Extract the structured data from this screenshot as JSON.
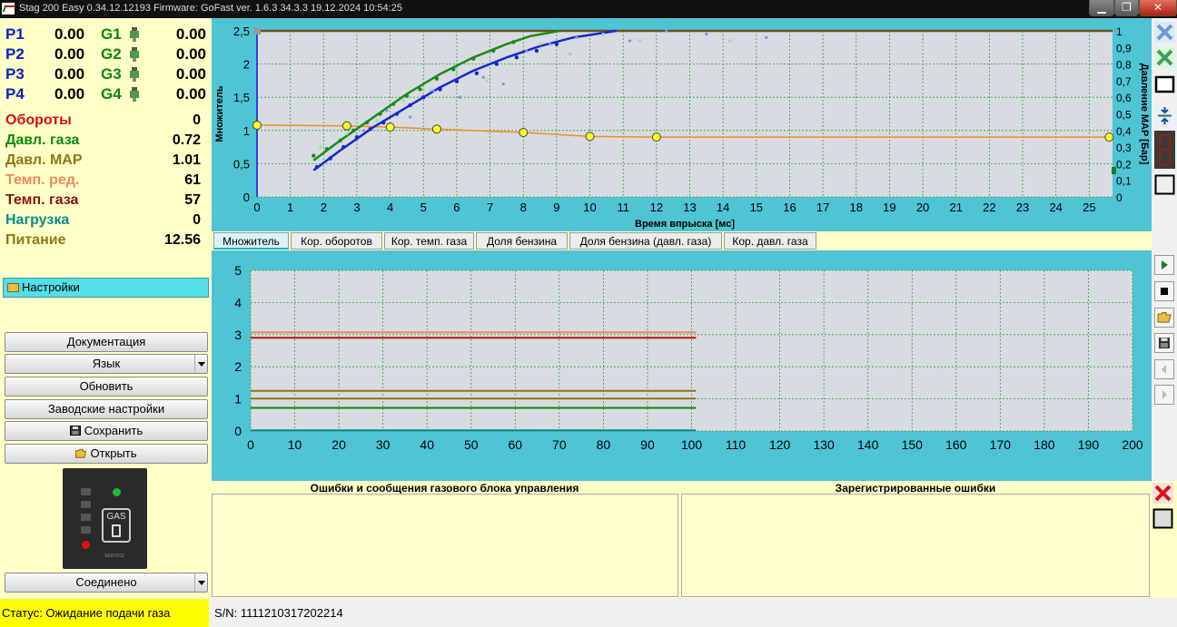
{
  "window": {
    "title": "Stag 200 Easy 0.34.12.12193 Firmware: GoFast  ver. 1.6.3  34.3.3   19.12.2024 10:54:25",
    "min": "▁",
    "max": "❐",
    "close": "✕"
  },
  "channels": [
    {
      "p": "P1",
      "pv": "0.00",
      "g": "G1",
      "gv": "0.00"
    },
    {
      "p": "P2",
      "pv": "0.00",
      "g": "G2",
      "gv": "0.00"
    },
    {
      "p": "P3",
      "pv": "0.00",
      "g": "G3",
      "gv": "0.00"
    },
    {
      "p": "P4",
      "pv": "0.00",
      "g": "G4",
      "gv": "0.00"
    }
  ],
  "params": [
    {
      "label": "Обороты",
      "value": "0",
      "color": "#d01010"
    },
    {
      "label": "Давл. газа",
      "value": "0.72",
      "color": "#0a8a0a"
    },
    {
      "label": "Давл. MAP",
      "value": "1.01",
      "color": "#8a7a10"
    },
    {
      "label": "Темп. ред.",
      "value": "61",
      "color": "#f08858"
    },
    {
      "label": "Темп. газа",
      "value": "57",
      "color": "#8a1010"
    },
    {
      "label": "Нагрузка",
      "value": "0",
      "color": "#0a8a8a"
    },
    {
      "label": "Питание",
      "value": "12.56",
      "color": "#8a7a10"
    }
  ],
  "settings": {
    "label": "Настройки"
  },
  "buttons": {
    "docs": "Документация",
    "language": "Язык",
    "update": "Обновить",
    "factory": "Заводские настройки",
    "save": "Сохранить",
    "open": "Открыть",
    "connection": "Соединено"
  },
  "device": {
    "gas": "GAS",
    "service": "SERVICE"
  },
  "tabs": [
    "Множитель",
    "Кор. оборотов",
    "Кор. темп. газа",
    "Доля бензина",
    "Доля бензина (давл. газа)",
    "Кор. давл. газа"
  ],
  "status": {
    "text": "Статус: Ожидание подачи газа",
    "serial": "S/N: 1111210317202214"
  },
  "messages": {
    "left_title": "Ошибки и сообщения газового блока управления",
    "right_title": "Зарегистрированные ошибки"
  },
  "colors": {
    "frame": "#4fc4d4",
    "plot_bg": "#d9dbe3",
    "grid": "#2ca02c",
    "orange": "#f0901a",
    "blue": "#1428d0",
    "green": "#1a8a1a",
    "brown": "#6b5218"
  },
  "icons": {
    "right_top": [
      "close-blue-icon",
      "close-green-icon",
      "window-icon",
      "compress-icon",
      "digit-icon",
      "empty-box-icon"
    ],
    "right_mid": [
      "play-icon",
      "stop-icon",
      "open-folder-icon",
      "save-disk-icon",
      "prev-icon",
      "next-icon"
    ],
    "right_bot": [
      "close-red-icon",
      "empty-box-icon"
    ]
  },
  "chart_data": [
    {
      "type": "line",
      "xlabel": "Время впрыска [мс]",
      "ylabel": "Множитель",
      "y2label": "Давление MAP [Бар]",
      "xlim": [
        0,
        25.7
      ],
      "ylim": [
        0,
        2.5
      ],
      "y2lim": [
        0,
        1
      ],
      "x_ticks": [
        0,
        1,
        2,
        3,
        4,
        5,
        6,
        7,
        8,
        9,
        10,
        11,
        12,
        13,
        14,
        15,
        16,
        17,
        18,
        19,
        20,
        21,
        22,
        23,
        24,
        25
      ],
      "y_ticks": [
        "0",
        "0,5",
        "1",
        "1,5",
        "2",
        "2,5"
      ],
      "y2_ticks": [
        "0",
        "0,1",
        "0,2",
        "0,3",
        "0,4",
        "0,5",
        "0,6",
        "0,7",
        "0,8",
        "0,9",
        "1"
      ],
      "grid": true,
      "series": [
        {
          "kind": "multiplier-curve",
          "color": "#f0901a",
          "x": [
            0,
            2.7,
            4,
            5.4,
            8,
            10,
            12,
            25.6
          ],
          "y": [
            1.08,
            1.07,
            1.05,
            1.02,
            0.97,
            0.91,
            0.9,
            0.9
          ],
          "markers": true
        },
        {
          "kind": "fit-blue",
          "color": "#1428d0",
          "x": [
            1.7,
            2.5,
            3.5,
            4.5,
            5.5,
            6.5,
            7.5,
            8.5,
            9.5,
            10.8
          ],
          "y": [
            0.4,
            0.7,
            1.05,
            1.35,
            1.65,
            1.9,
            2.1,
            2.27,
            2.4,
            2.5
          ]
        },
        {
          "kind": "fit-green",
          "color": "#1a8a1a",
          "x": [
            1.7,
            2.5,
            3.5,
            4.5,
            5.5,
            6.5,
            7.5,
            8.2,
            9.1
          ],
          "y": [
            0.55,
            0.85,
            1.2,
            1.55,
            1.85,
            2.1,
            2.3,
            2.42,
            2.5
          ]
        },
        {
          "kind": "points-blue",
          "color": "#1428d0",
          "x": [
            1.8,
            2.2,
            2.6,
            3.0,
            3.4,
            3.8,
            4.2,
            4.6,
            5.0,
            5.5,
            6.0,
            6.6,
            7.2,
            7.8,
            8.4,
            9.0
          ],
          "y": [
            0.45,
            0.58,
            0.75,
            0.9,
            1.02,
            1.12,
            1.25,
            1.38,
            1.5,
            1.62,
            1.74,
            1.86,
            2.0,
            2.1,
            2.2,
            2.3
          ]
        },
        {
          "kind": "points-green",
          "color": "#1a8a1a",
          "x": [
            1.7,
            2.1,
            2.5,
            2.9,
            3.3,
            3.7,
            4.1,
            4.5,
            4.9,
            5.4,
            5.9,
            6.5,
            7.1,
            7.7
          ],
          "y": [
            0.62,
            0.72,
            0.85,
            1.0,
            1.12,
            1.25,
            1.4,
            1.52,
            1.62,
            1.78,
            1.92,
            2.08,
            2.2,
            2.33
          ]
        },
        {
          "kind": "points-light-blue",
          "color": "#8a8ae8",
          "x": [
            3.2,
            3.9,
            4.6,
            5.3,
            6.1,
            6.8,
            7.4,
            8.1,
            8.8,
            9.6,
            10.4,
            11.2,
            12.3,
            13.5,
            15.3
          ],
          "y": [
            1.0,
            1.3,
            1.2,
            1.6,
            1.5,
            1.8,
            1.7,
            2.2,
            2.3,
            2.4,
            2.45,
            2.35,
            2.5,
            2.45,
            2.4
          ]
        },
        {
          "kind": "points-light-green",
          "color": "#98e098",
          "x": [
            1.9,
            2.7,
            3.6,
            4.4,
            5.2,
            6.0,
            6.9,
            7.6,
            8.5,
            9.4,
            10.4,
            11.5,
            14.2
          ],
          "y": [
            0.75,
            0.95,
            1.15,
            1.45,
            1.6,
            1.85,
            1.75,
            2.0,
            2.3,
            2.15,
            2.45,
            2.35,
            2.35
          ]
        }
      ]
    },
    {
      "type": "line",
      "xlim": [
        0,
        200
      ],
      "ylim": [
        0,
        5
      ],
      "x_ticks": [
        0,
        10,
        20,
        30,
        40,
        50,
        60,
        70,
        80,
        90,
        100,
        110,
        120,
        130,
        140,
        150,
        160,
        170,
        180,
        190,
        200
      ],
      "y_ticks": [
        0,
        1,
        2,
        3,
        4,
        5
      ],
      "grid": true,
      "series": [
        {
          "color": "#f08858",
          "x": [
            0,
            101
          ],
          "y": [
            3.07,
            3.07
          ]
        },
        {
          "color": "#c01010",
          "x": [
            0,
            101
          ],
          "y": [
            2.9,
            2.9
          ]
        },
        {
          "color": "#8a7a10",
          "x": [
            0,
            101
          ],
          "y": [
            1.25,
            1.25
          ]
        },
        {
          "color": "#8a7a10",
          "x": [
            0,
            101
          ],
          "y": [
            1.01,
            1.01
          ]
        },
        {
          "color": "#0a8a0a",
          "x": [
            0,
            101
          ],
          "y": [
            0.72,
            0.72
          ]
        },
        {
          "color": "#0a8a8a",
          "x": [
            0,
            101
          ],
          "y": [
            0.02,
            0.02
          ]
        }
      ]
    }
  ]
}
